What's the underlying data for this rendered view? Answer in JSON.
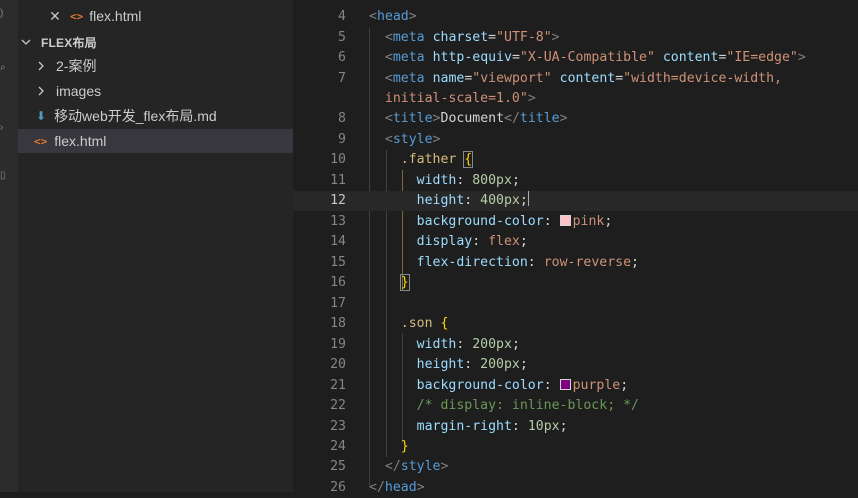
{
  "sidebar": {
    "open_editor_file": "flex.html",
    "section_title": "FLEX布局",
    "items": [
      {
        "label": "2-案例",
        "kind": "folder"
      },
      {
        "label": "images",
        "kind": "folder"
      },
      {
        "label": "移动web开发_flex布局.md",
        "kind": "markdown"
      },
      {
        "label": "flex.html",
        "kind": "html"
      }
    ]
  },
  "icons": {
    "close": "close-icon",
    "html": "html-file-icon",
    "markdown": "markdown-file-icon",
    "chevron": "chevron-icon"
  },
  "editor": {
    "current_line": "12",
    "lines": [
      {
        "n": "4"
      },
      {
        "n": "5"
      },
      {
        "n": "6"
      },
      {
        "n": "7"
      },
      {
        "n": ""
      },
      {
        "n": "8"
      },
      {
        "n": "9"
      },
      {
        "n": "10"
      },
      {
        "n": "11"
      },
      {
        "n": "12"
      },
      {
        "n": "13"
      },
      {
        "n": "14"
      },
      {
        "n": "15"
      },
      {
        "n": "16"
      },
      {
        "n": "17"
      },
      {
        "n": "18"
      },
      {
        "n": "19"
      },
      {
        "n": "20"
      },
      {
        "n": "21"
      },
      {
        "n": "22"
      },
      {
        "n": "23"
      },
      {
        "n": "24"
      },
      {
        "n": "25"
      },
      {
        "n": "26"
      }
    ],
    "swatches": {
      "pink": "#ffc0cb",
      "purple": "#800080"
    }
  },
  "tokens": {
    "head": "head",
    "meta": "meta",
    "title": "title",
    "style": "style",
    "charset": "charset",
    "charset_val": "\"UTF-8\"",
    "http_equiv": "http-equiv",
    "http_equiv_val": "\"X-UA-Compatible\"",
    "content": "content",
    "content_ie": "\"IE=edge\"",
    "name": "name",
    "viewport_val": "\"viewport\"",
    "viewport_content_1": "\"width=device-width,",
    "viewport_content_2": "initial-scale=1.0\"",
    "document": "Document",
    "father": ".father",
    "son": ".son",
    "width": "width",
    "height": "height",
    "background_color": "background-color",
    "display": "display",
    "flex": "flex",
    "flex_direction": "flex-direction",
    "row_reverse": "row-reverse",
    "margin_right": "margin-right",
    "px800": "800px",
    "px400": "400px",
    "px200": "200px",
    "px10": "10px",
    "pink": "pink",
    "purple": "purple",
    "comment": "/* display: inline-block; */"
  }
}
